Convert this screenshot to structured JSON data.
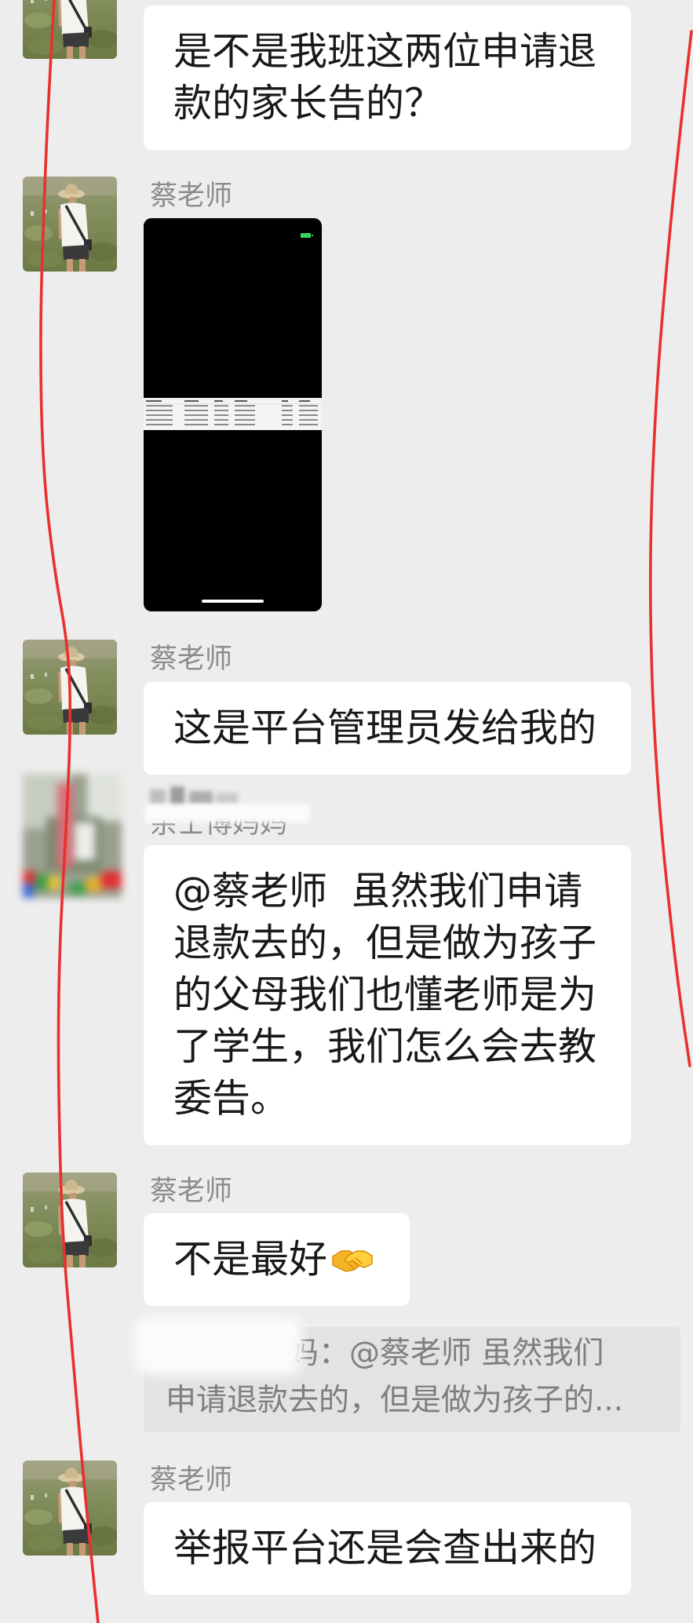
{
  "chat": {
    "messages": [
      {
        "lines": [
          "是不是我班这两位申请退",
          "款的家长告的？"
        ]
      },
      {
        "sender": "蔡老师"
      },
      {
        "sender": "蔡老师",
        "lines": [
          "这是平台管理员发给我的"
        ]
      },
      {
        "sender": "余士博妈妈",
        "lines": [
          "@蔡老师  虽然我们申请",
          "退款去的，但是做为孩子",
          "的父母我们也懂老师是为",
          "了学生，我们怎么会去教",
          "委告。"
        ]
      },
      {
        "sender": "蔡老师",
        "text": "不是最好",
        "emoji": "handshake-emoji"
      },
      {
        "sender": "蔡老师",
        "lines": [
          "举报平台还是会查出来的"
        ]
      }
    ],
    "quote": {
      "lines": [
        "妈：@蔡老师 虽然我们",
        "申请退款去的，但是做为孩子的..."
      ]
    }
  },
  "icons": {
    "image_status": "battery-icon"
  },
  "colors": {
    "page_background": "#ededed",
    "bubble_background": "#ffffff",
    "quote_background": "#e3e3e3",
    "sender_name": "#8c8c8c",
    "annotation_red": "#e8312f"
  }
}
